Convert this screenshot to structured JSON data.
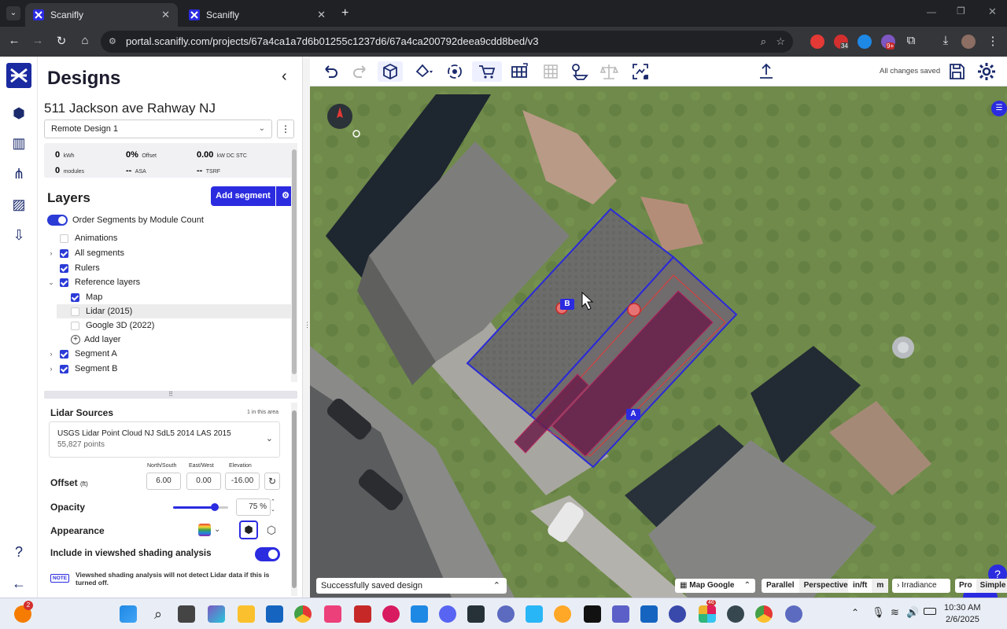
{
  "browser": {
    "tabs": [
      {
        "title": "Scanifly",
        "active": true
      },
      {
        "title": "Scanifly",
        "active": false
      }
    ],
    "url": "portal.scanifly.com/projects/67a4ca1a7d6b01255c1237d6/67a4ca200792deea9cdd8bed/v3",
    "ext_badges": [
      "34",
      "9+"
    ]
  },
  "panel": {
    "title": "Designs",
    "address": "511 Jackson ave Rahway NJ",
    "design_select": "Remote Design 1",
    "stats": {
      "kwh": "0",
      "kwh_unit": "kWh",
      "offset": "0%",
      "offset_label": "Offset",
      "kw": "0.00",
      "kw_unit": "kW DC STC",
      "modules": "0",
      "modules_label": "modules",
      "asa": "--",
      "asa_label": "ASA",
      "tsrf": "--",
      "tsrf_label": "TSRF"
    },
    "layers_title": "Layers",
    "add_segment": "Add segment",
    "order_label": "Order Segments by Module Count",
    "layers": {
      "animations": "Animations",
      "all_segments": "All segments",
      "rulers": "Rulers",
      "reference_layers": "Reference layers",
      "map": "Map",
      "lidar": "Lidar (2015)",
      "google3d": "Google 3D (2022)",
      "add_layer": "Add layer",
      "segment_a": "Segment A",
      "segment_b": "Segment B"
    },
    "lidar_sources": {
      "title": "Lidar Sources",
      "count": "1 in this area",
      "source_name": "USGS Lidar Point Cloud NJ SdL5 2014 LAS 2015",
      "points": "55,827 points"
    },
    "offset": {
      "label": "Offset",
      "unit": "(ft)",
      "ns_label": "North/South",
      "ns_value": "6.00",
      "ew_label": "East/West",
      "ew_value": "0.00",
      "el_label": "Elevation",
      "el_value": "-16.00"
    },
    "opacity": {
      "label": "Opacity",
      "value": "75",
      "unit": "%",
      "fraction": 0.75
    },
    "appearance": {
      "label": "Appearance"
    },
    "viewshed": {
      "label": "Include in viewshed shading analysis",
      "note_tag": "NOTE",
      "note": "Viewshed shading analysis will not detect Lidar data if this is turned off."
    }
  },
  "toolbar": {
    "status": "All changes saved"
  },
  "map": {
    "segment_labels": [
      "A",
      "B"
    ],
    "toast": "Successfully saved design",
    "map_source": "Map Google",
    "view_modes": [
      "Parallel",
      "Perspective"
    ],
    "units": [
      "in/ft",
      "m"
    ],
    "irradiance": "Irradiance",
    "modes": [
      "Pro",
      "Simple"
    ]
  },
  "taskbar": {
    "time": "10:30 AM",
    "date": "2/6/2025",
    "badge_weather": "2",
    "badge_app": "46"
  },
  "colors": {
    "brand": "#1a2a6c",
    "accent": "#2b2be0",
    "segment_outline": "#2a2ad8",
    "setback": "#e53935",
    "module_fill": "#6a1f4a"
  }
}
